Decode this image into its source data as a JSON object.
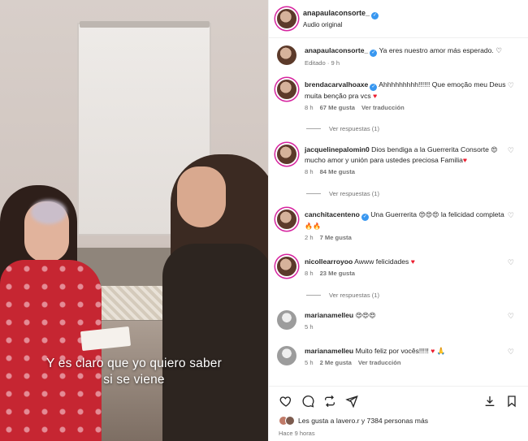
{
  "video": {
    "subtitle_line1": "Y es claro que yo quiero saber",
    "subtitle_line2": "si se viene"
  },
  "post": {
    "username": "anapaulaconsorte_",
    "audio": "Audio original"
  },
  "caption": {
    "username": "anapaulaconsorte_",
    "text": "Ya eres nuestro amor más esperado.",
    "meta": "Editado · 9 h"
  },
  "comments": [
    {
      "username": "brendacarvalhoaxe",
      "text": "Ahhhhhhhhh!!!!!! Que emoção meu Deus muita benção pra vcs",
      "emoji": "♥",
      "time": "8 h",
      "likes": "67 Me gusta",
      "translate": "Ver traducción",
      "replies": "Ver respuestas (1)"
    },
    {
      "username": "jacquelinepalomin0",
      "text": "Dios bendiga a la Guerrerita Consorte",
      "emoji_mid": "😍",
      "text2": "mucho amor y unión para ustedes preciosa Familia",
      "emoji": "♥",
      "time": "8 h",
      "likes": "84 Me gusta",
      "replies": "Ver respuestas (1)"
    },
    {
      "username": "canchitacenteno",
      "text": "Una Guerrerita",
      "emoji_mid": "😍😍😍",
      "text2": "la felicidad completa",
      "emoji": "🔥🔥",
      "time": "2 h",
      "likes": "7 Me gusta"
    },
    {
      "username": "nicollearroyoo",
      "text": "Awww felicidades",
      "emoji": "♥",
      "time": "8 h",
      "likes": "23 Me gusta",
      "replies": "Ver respuestas (1)"
    },
    {
      "username": "marianamelleu",
      "text": "",
      "emoji": "😍😍😍",
      "time": "5 h"
    },
    {
      "username": "marianamelleu",
      "text": "Muito feliz por vocês!!!!!",
      "emoji": "♥ 🙏",
      "time": "5 h",
      "likes": "2 Me gusta",
      "translate": "Ver traducción"
    }
  ],
  "likes": {
    "text": "Les gusta a lavero.r y 7384 personas más"
  },
  "time_ago": "Hace 9 horas",
  "icons": [
    "heart-icon",
    "comment-icon",
    "repost-icon",
    "share-icon",
    "save-icon",
    "bookmark-icon"
  ]
}
